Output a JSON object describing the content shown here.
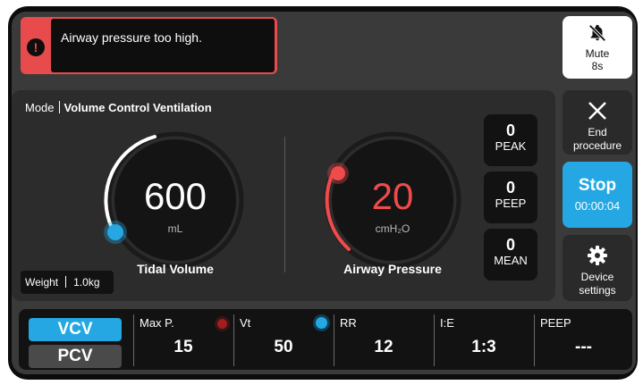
{
  "alarm": {
    "message": "Airway pressure too high.",
    "icon": "alert-icon",
    "color": "#e84b4b"
  },
  "mute": {
    "label": "Mute",
    "countdown": "8s",
    "icon": "bell-off-icon"
  },
  "side": {
    "end_label_1": "End",
    "end_label_2": "procedure",
    "stop_label": "Stop",
    "stop_timer": "00:00:04",
    "settings_label_1": "Device",
    "settings_label_2": "settings",
    "accent": "#25a7e3"
  },
  "main": {
    "mode_label": "Mode",
    "mode_value": "Volume Control Ventilation",
    "tidal": {
      "value": "600",
      "unit": "mL",
      "label": "Tidal Volume"
    },
    "pressure": {
      "value": "20",
      "unit": "cmH₂O",
      "label": "Airway Pressure",
      "color": "#ef4b4b"
    },
    "weight_label": "Weight",
    "weight_value": "1.0kg",
    "stats": [
      {
        "value": "0",
        "name": "PEAK"
      },
      {
        "value": "0",
        "name": "PEEP"
      },
      {
        "value": "0",
        "name": "MEAN"
      }
    ]
  },
  "bottom": {
    "modes": {
      "active": "VCV",
      "inactive": "PCV"
    },
    "params": [
      {
        "name": "Max P.",
        "value": "15"
      },
      {
        "name": "Vt",
        "value": "50"
      },
      {
        "name": "RR",
        "value": "12"
      },
      {
        "name": "I:E",
        "value": "1:3"
      },
      {
        "name": "PEEP",
        "value": "---"
      }
    ]
  }
}
